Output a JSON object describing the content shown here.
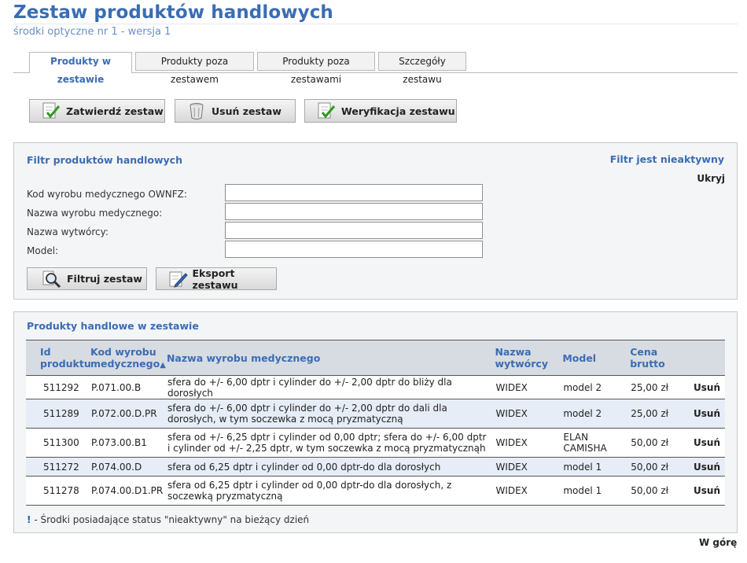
{
  "page": {
    "title": "Zestaw produktów handlowych",
    "subtitle": "środki optyczne nr 1 - wersja 1"
  },
  "tabs": [
    {
      "label": "Produkty w zestawie",
      "active": true
    },
    {
      "label": "Produkty poza zestawem",
      "active": false
    },
    {
      "label": "Produkty poza zestawami",
      "active": false
    },
    {
      "label": "Szczegóły zestawu",
      "active": false
    }
  ],
  "actions": {
    "confirm": "Zatwierdź zestaw",
    "delete": "Usuń zestaw",
    "verify": "Weryfikacja zestawu"
  },
  "filter": {
    "title": "Filtr produktów handlowych",
    "status": "Filtr jest nieaktywny",
    "hide": "Ukryj",
    "fields": [
      {
        "label": "Kod wyrobu medycznego OWNFZ:",
        "value": ""
      },
      {
        "label": "Nazwa wyrobu medycznego:",
        "value": ""
      },
      {
        "label": "Nazwa wytwórcy:",
        "value": ""
      },
      {
        "label": "Model:",
        "value": ""
      }
    ],
    "filter_button": "Filtruj zestaw",
    "export_button": "Eksport zestawu"
  },
  "products": {
    "title": "Produkty handlowe w zestawie",
    "columns": {
      "id": "Id produktu",
      "code": "Kod wyrobu medycznego",
      "sort_indicator": "▲",
      "name": "Nazwa wyrobu medycznego",
      "maker": "Nazwa wytwórcy",
      "model": "Model",
      "price": "Cena brutto"
    },
    "rows": [
      {
        "id": "511292",
        "code": "P.071.00.B",
        "name": "sfera do +/- 6,00 dptr i cylinder do +/- 2,00 dptr do bliży dla dorosłych",
        "maker": "WIDEX",
        "model": "model 2",
        "price": "25,00 zł",
        "action": "Usuń"
      },
      {
        "id": "511289",
        "code": "P.072.00.D.PR",
        "name": "sfera do +/- 6,00 dptr i cylinder do +/- 2,00 dptr do dali dla dorosłych, w tym soczewka z mocą pryzmatyczną",
        "maker": "WIDEX",
        "model": "model 2",
        "price": "25,00 zł",
        "action": "Usuń"
      },
      {
        "id": "511300",
        "code": "P.073.00.B1",
        "name": "sfera od +/- 6,25 dptr i cylinder od 0,00 dptr; sfera do +/- 6,00 dptr i cylinder od +/- 2,25 dptr, w tym soczewka z mocą pryzmatycznąh",
        "maker": "WIDEX",
        "model": "ELAN CAMISHA",
        "price": "50,00 zł",
        "action": "Usuń"
      },
      {
        "id": "511272",
        "code": "P.074.00.D",
        "name": "sfera od 6,25 dptr i cylinder od 0,00 dptr-do dla dorosłych",
        "maker": "WIDEX",
        "model": "model 1",
        "price": "50,00 zł",
        "action": "Usuń"
      },
      {
        "id": "511278",
        "code": "P.074.00.D1.PR",
        "name": "sfera od 6,25 dptr i cylinder od 0,00 dptr-do dla dorosłych, z soczewką pryzmatyczną",
        "maker": "WIDEX",
        "model": "model 1",
        "price": "50,00 zł",
        "action": "Usuń"
      }
    ],
    "note_mark": "!",
    "note": "- Środki posiadające status \"nieaktywny\" na bieżący dzień"
  },
  "footer": {
    "top_link": "W górę"
  }
}
